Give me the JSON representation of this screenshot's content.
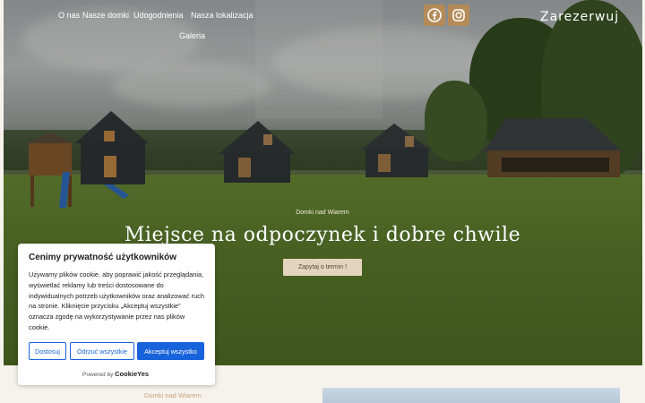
{
  "nav": {
    "links": [
      "O nas",
      "Nasze domki",
      "Udogodnienia",
      "Nasza lokalizacja",
      "Galeria"
    ],
    "reserve_label": "Zarezerwuj"
  },
  "social": [
    {
      "icon": "facebook-icon"
    },
    {
      "icon": "instagram-icon"
    }
  ],
  "hero": {
    "kicker": "Domki nad Wiarem",
    "title": "Miejsce na odpoczynek i dobre chwile",
    "cta_label": "Zapytaj o termin !"
  },
  "cookie_banner": {
    "title": "Cenimy prywatność użytkowników",
    "text": "Używamy plików cookie, aby poprawić jakość przeglądania, wyświetlać reklamy lub treści dostosowane do indywidualnych potrzeb użytkowników oraz analizować ruch na stronie. Kliknięcie przycisku „Akceptuj wszystkie” oznacza zgodę na wykorzystywanie przez nas plików cookie.",
    "customize_label": "Dostosuj",
    "reject_label": "Odrzuć wszystkie",
    "accept_label": "Akceptuj wszystko",
    "powered_by": "Powered by",
    "brand": "CookieYes"
  },
  "below": {
    "label": "Domki nad Wiarem"
  },
  "colors": {
    "accent_brown": "#b48b58",
    "cta_bg": "#e3d4bd",
    "cookie_blue": "#1863dc",
    "page_bg": "#f6f2ec"
  }
}
